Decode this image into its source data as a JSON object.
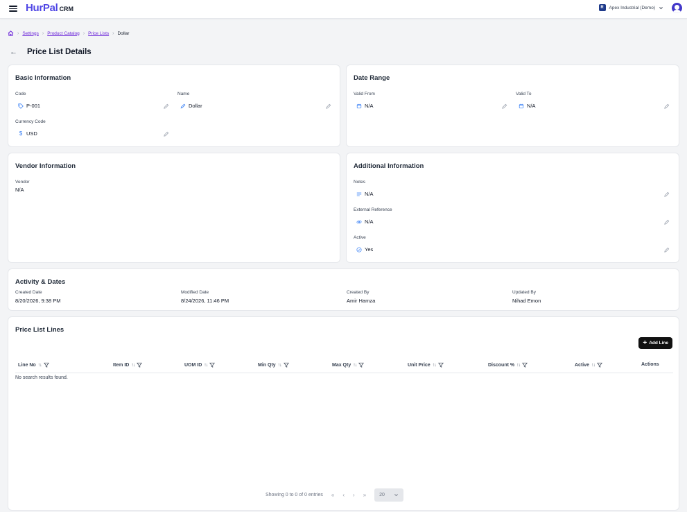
{
  "header": {
    "logo_main": "HurPal",
    "logo_sub": "CRM",
    "org_initial": "R",
    "org_name": "Apex Industrial (Demo)"
  },
  "breadcrumb": {
    "items": [
      "Settings",
      "Product Catalog",
      "Price Lists"
    ],
    "current": "Dollar"
  },
  "page": {
    "title": "Price List Details"
  },
  "basic": {
    "title": "Basic Information",
    "code_label": "Code",
    "code_value": "P-001",
    "name_label": "Name",
    "name_value": "Dollar",
    "currency_label": "Currency Code",
    "currency_value": "USD"
  },
  "date_range": {
    "title": "Date Range",
    "from_label": "Valid From",
    "from_value": "N/A",
    "to_label": "Valid To",
    "to_value": "N/A"
  },
  "vendor": {
    "title": "Vendor Information",
    "vendor_label": "Vendor",
    "vendor_value": "N/A"
  },
  "additional": {
    "title": "Additional Information",
    "notes_label": "Notes",
    "notes_value": "N/A",
    "extref_label": "External Reference",
    "extref_value": "N/A",
    "active_label": "Active",
    "active_value": "Yes"
  },
  "activity": {
    "title": "Activity & Dates",
    "created_date_label": "Created Date",
    "created_date_value": "8/20/2026, 9:38 PM",
    "modified_date_label": "Modified Date",
    "modified_date_value": "8/24/2026, 11:46 PM",
    "created_by_label": "Created By",
    "created_by_value": "Amir Hamza",
    "updated_by_label": "Updated By",
    "updated_by_value": "Nihad Emon"
  },
  "lines": {
    "title": "Price List Lines",
    "add_label": "Add Line",
    "columns": [
      "Line No",
      "Item ID",
      "UOM ID",
      "Min Qty",
      "Max Qty",
      "Unit Price",
      "Discount %",
      "Active",
      "Actions"
    ],
    "empty_text": "No search results found.",
    "pager_text": "Showing 0 to 0 of 0 entries",
    "page_size": "20"
  },
  "colors": {
    "accent": "#4f46e5",
    "link": "#6d28d9",
    "icon_blue": "#3b82f6",
    "button_dark": "#111111"
  }
}
